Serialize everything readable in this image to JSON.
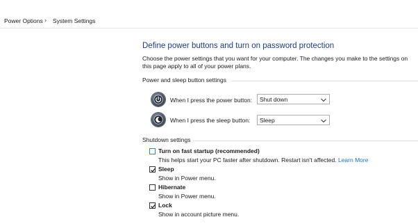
{
  "breadcrumb": {
    "items": [
      "Power Options",
      "System Settings"
    ],
    "separator": "›"
  },
  "main": {
    "title": "Define power buttons and turn on password protection",
    "description": "Choose the power settings that you want for your computer. The changes you make to the settings on this page apply to all of your power plans."
  },
  "power_sleep": {
    "header": "Power and sleep button settings",
    "power_button": {
      "label": "When I press the power button:",
      "value": "Shut down",
      "icon": "power-icon"
    },
    "sleep_button": {
      "label": "When I press the sleep button:",
      "value": "Sleep",
      "icon": "moon-icon"
    }
  },
  "shutdown": {
    "header": "Shutdown settings",
    "fast_startup": {
      "label": "Turn on fast startup (recommended)",
      "checked": false,
      "desc": "This helps start your PC faster after shutdown. Restart isn't affected.",
      "link": "Learn More"
    },
    "sleep": {
      "label": "Sleep",
      "checked": true,
      "desc": "Show in Power menu."
    },
    "hibernate": {
      "label": "Hibernate",
      "checked": false,
      "desc": "Show in Power menu."
    },
    "lock": {
      "label": "Lock",
      "checked": true,
      "desc": "Show in account picture menu."
    }
  },
  "colors": {
    "title": "#1e3a8a",
    "link": "#1f6fbf",
    "separator_line": "#dcdcdc"
  }
}
